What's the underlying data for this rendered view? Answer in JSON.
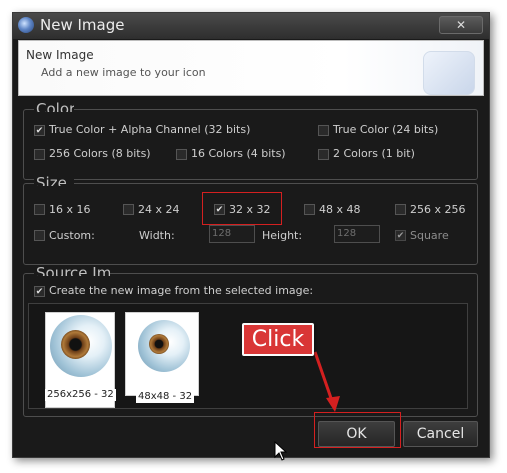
{
  "window": {
    "title": "New Image",
    "close_label": "✕",
    "header": {
      "title": "New Image",
      "subtitle": "Add a new image to your icon"
    }
  },
  "colors_group": {
    "legend": "Colors",
    "options": [
      {
        "label": "True Color + Alpha Channel (32 bits)",
        "checked": true
      },
      {
        "label": "True Color (24 bits)",
        "checked": false
      },
      {
        "label": "256 Colors (8 bits)",
        "checked": false
      },
      {
        "label": "16 Colors (4 bits)",
        "checked": false
      },
      {
        "label": "2 Colors (1 bit)",
        "checked": false
      }
    ]
  },
  "size_group": {
    "legend": "Size",
    "options": [
      {
        "label": "16 x 16",
        "checked": false
      },
      {
        "label": "24 x 24",
        "checked": false
      },
      {
        "label": "32 x 32",
        "checked": true
      },
      {
        "label": "48 x 48",
        "checked": false
      },
      {
        "label": "256 x 256",
        "checked": false
      }
    ],
    "custom_label": "Custom:",
    "width_label": "Width:",
    "width_value": "128",
    "height_label": "Height:",
    "height_value": "128",
    "square_label": "Square",
    "square_checked": true
  },
  "source_group": {
    "legend": "Source Image",
    "create_from_selected_label": "Create the new image from the selected image:",
    "create_from_selected_checked": true,
    "images": [
      {
        "caption": "256x256 - 32"
      },
      {
        "caption": "48x48 - 32"
      }
    ]
  },
  "annotation": {
    "callout_text": "Click",
    "accent_color": "#d42020"
  },
  "buttons": {
    "ok": "OK",
    "cancel": "Cancel"
  }
}
